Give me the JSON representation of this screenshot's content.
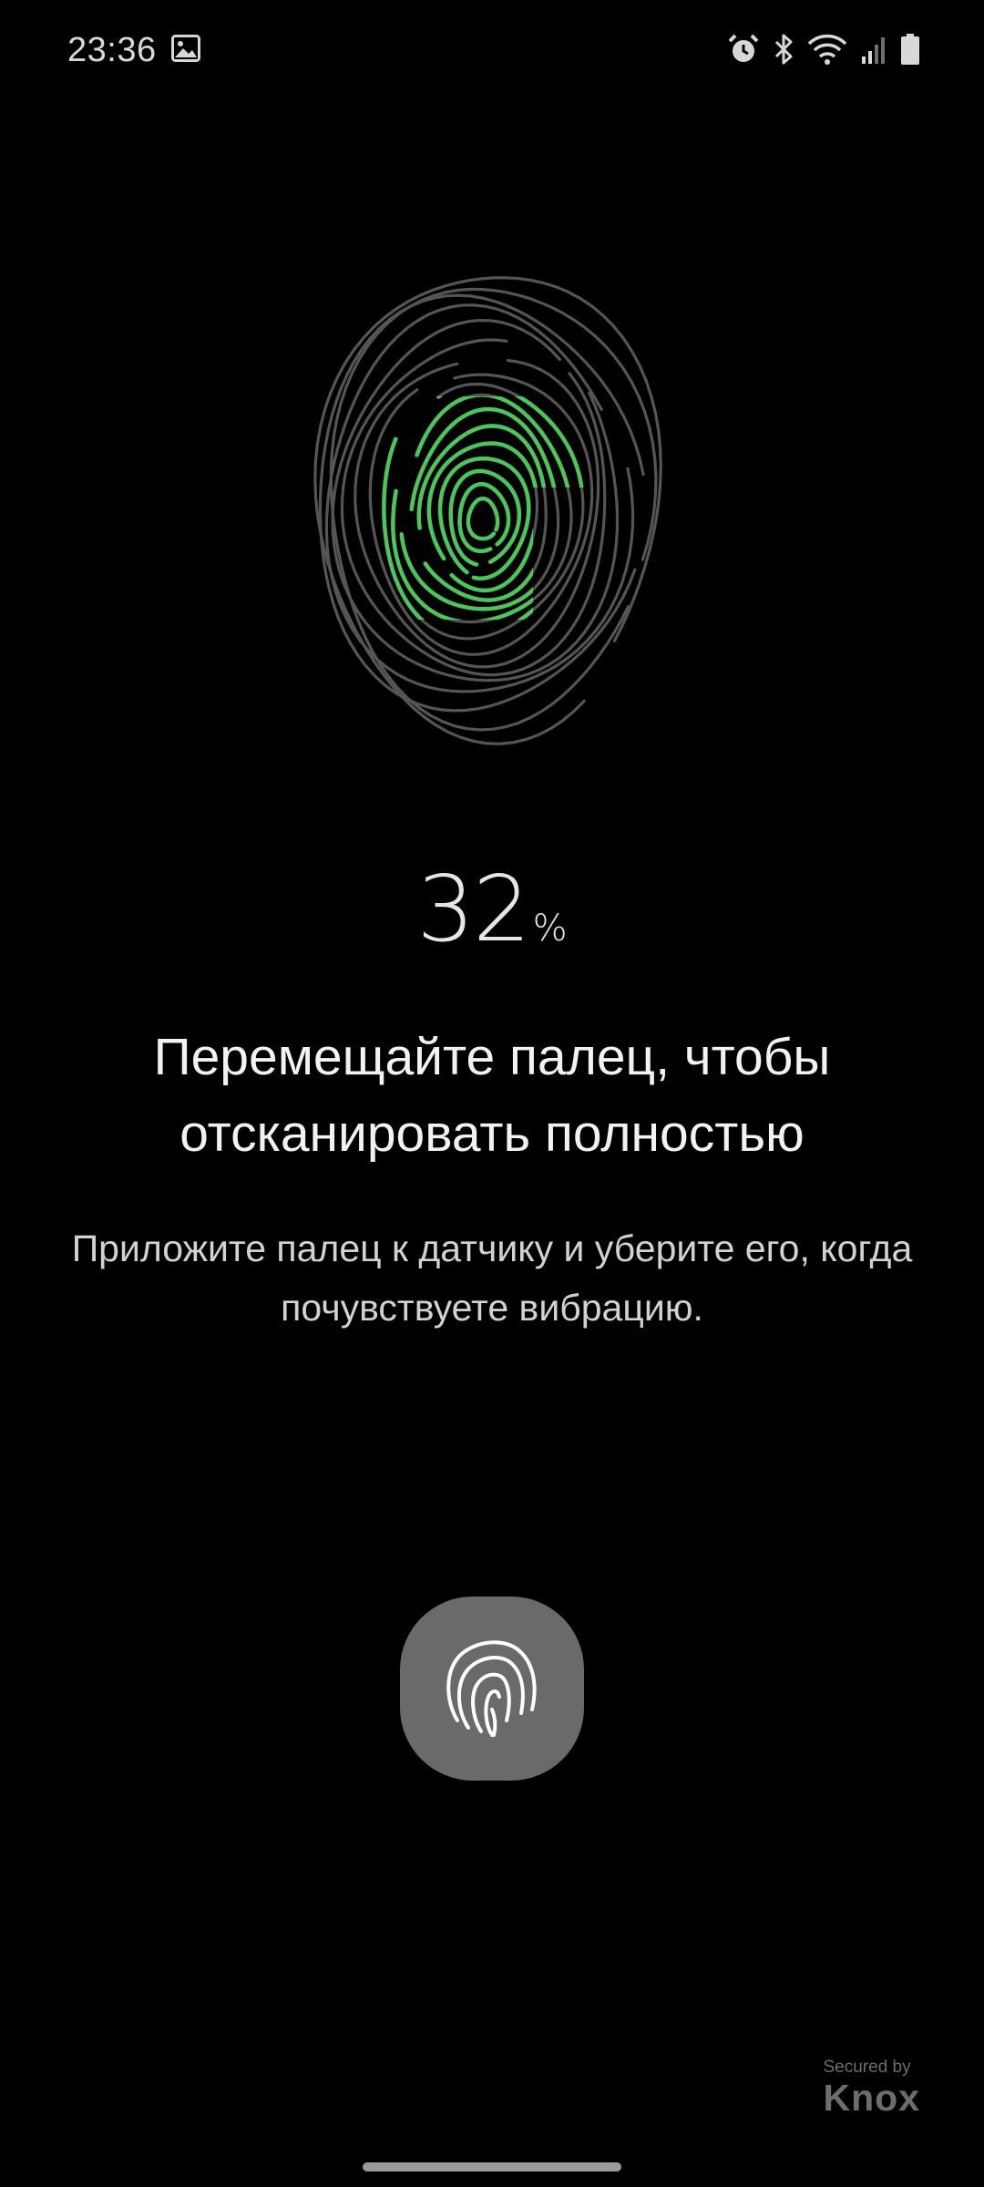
{
  "status_bar": {
    "time": "23:36",
    "left_icons": [
      "image-notification-icon"
    ],
    "right_icons": [
      "alarm-icon",
      "bluetooth-icon",
      "wifi-icon",
      "cellular-signal-icon",
      "battery-icon"
    ]
  },
  "scan": {
    "progress_value": "32",
    "progress_unit": "%",
    "progress_fraction": 0.32
  },
  "instructions": {
    "title": "Перемещайте палец, чтобы отсканировать полностью",
    "subtitle": "Приложите палец к датчику и уберите его, когда почувствуете вибрацию."
  },
  "sensor": {
    "icon": "fingerprint-icon"
  },
  "badge": {
    "secured_by": "Secured by",
    "brand": "Knox"
  },
  "colors": {
    "background": "#000000",
    "scanned_ridge": "#4cc65a",
    "unscanned_ridge": "#555555",
    "sensor_button": "#6a6a6a"
  }
}
